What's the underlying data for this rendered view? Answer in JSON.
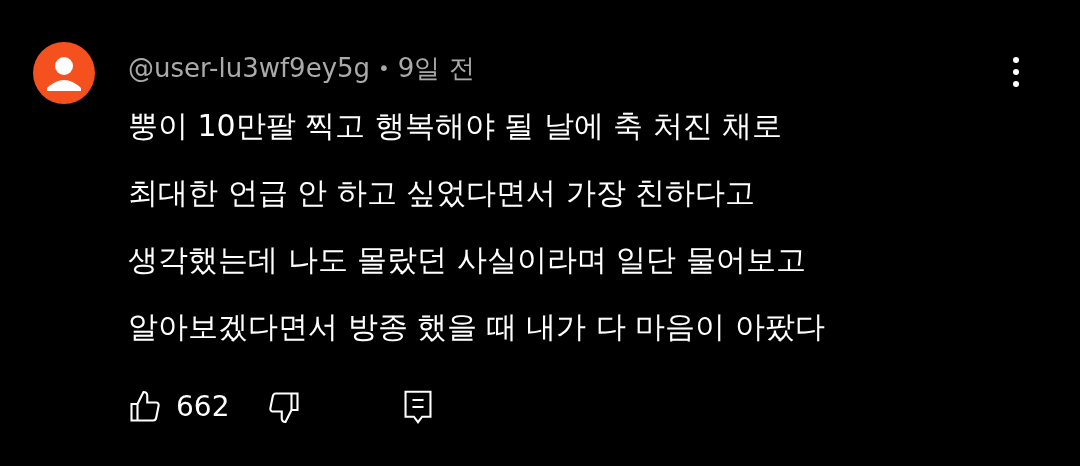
{
  "comment": {
    "author": "@user-lu3wf9ey5g",
    "separator": "•",
    "time": "9일 전",
    "lines": [
      "뿡이 10만팔 찍고 행복해야 될 날에 축 처진 채로",
      "최대한 언급 안 하고 싶었다면서 가장 친하다고",
      "생각했는데 나도 몰랐던 사실이라며 일단 물어보고",
      "알아보겠다면서 방종 했을 때 내가 다 마음이 아팠다"
    ],
    "likes": "662"
  }
}
